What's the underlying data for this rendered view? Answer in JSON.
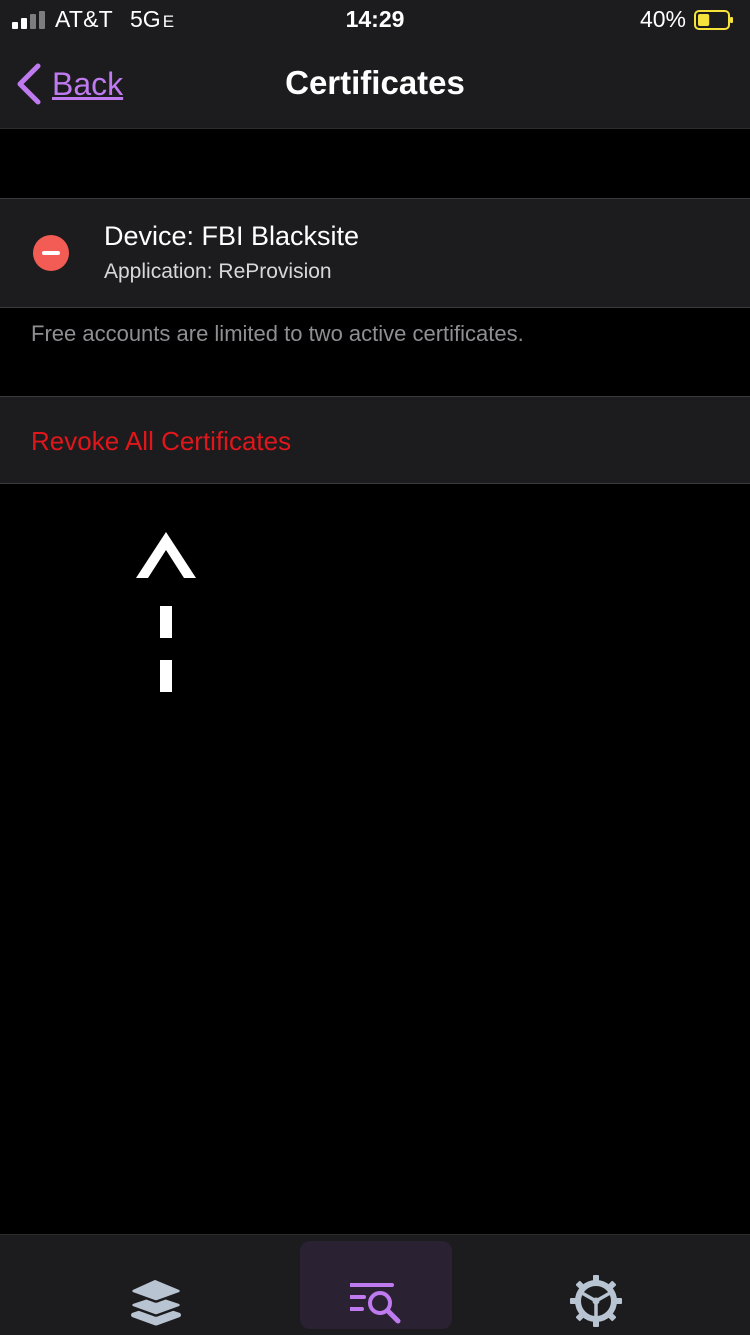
{
  "status_bar": {
    "carrier": "AT&T",
    "network": "5G",
    "network_sub": "E",
    "time": "14:29",
    "battery_percent": "40%",
    "battery_level": 0.4,
    "battery_color": "#f7e23b"
  },
  "nav": {
    "back_label": "Back",
    "title": "Certificates"
  },
  "certificates": [
    {
      "device": "Device: FBI Blacksite",
      "application": "Application: ReProvision"
    }
  ],
  "section_footer": "Free accounts are limited to two active certificates.",
  "revoke_label": "Revoke All Certificates",
  "tabs": [
    {
      "icon": "layers-icon",
      "selected": false
    },
    {
      "icon": "list-search-icon",
      "selected": true
    },
    {
      "icon": "gear-icon",
      "selected": false
    }
  ],
  "colors": {
    "accent": "#bf7af0",
    "destructive": "#e0161b",
    "delete_control": "#f25c54"
  }
}
